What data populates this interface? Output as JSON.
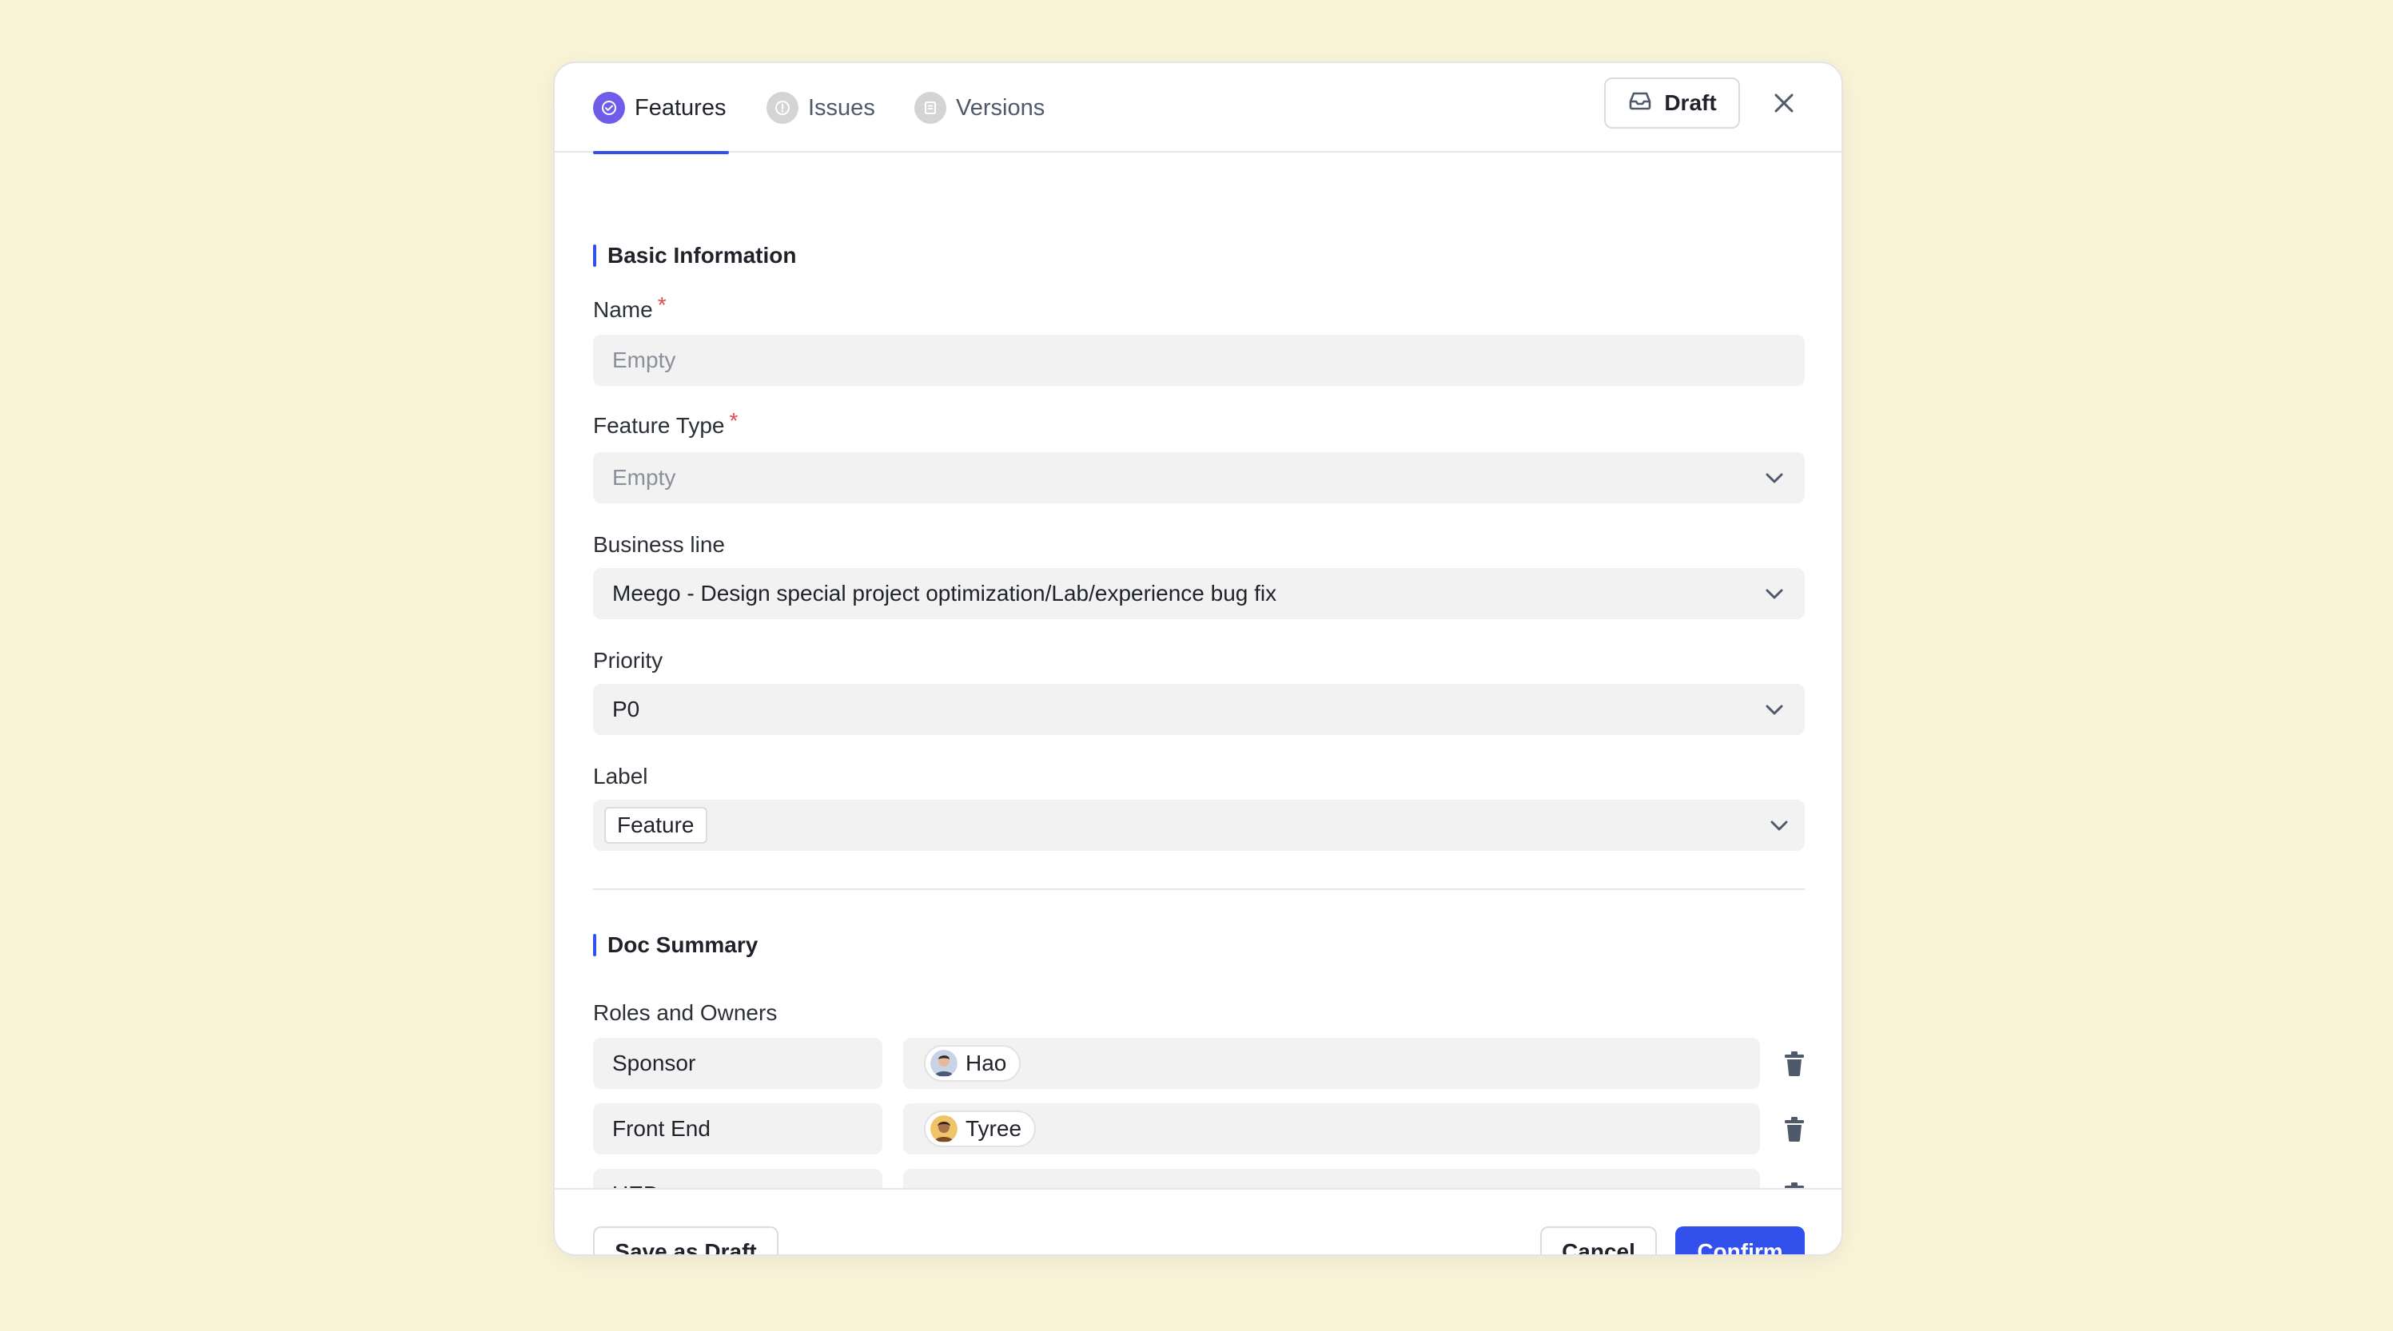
{
  "tabs": [
    {
      "label": "Features",
      "icon": "check-circle-icon",
      "active": true
    },
    {
      "label": "Issues",
      "icon": "alert-circle-icon",
      "active": false
    },
    {
      "label": "Versions",
      "icon": "bookmark-icon",
      "active": false
    }
  ],
  "header": {
    "draft_label": "Draft",
    "draft_icon": "inbox-icon",
    "close_icon": "close-icon"
  },
  "basic_info": {
    "title": "Basic Information",
    "name": {
      "label": "Name",
      "required": "*",
      "placeholder": "Empty"
    },
    "feature_type": {
      "label": "Feature Type",
      "required": "*",
      "placeholder": "Empty"
    },
    "business_line": {
      "label": "Business line",
      "value": "Meego - Design special project optimization/Lab/experience bug fix"
    },
    "priority": {
      "label": "Priority",
      "value": "P0"
    },
    "label": {
      "label": "Label",
      "tag": "Feature"
    }
  },
  "doc_summary": {
    "title": "Doc Summary",
    "roles_label": "Roles and Owners",
    "roles": [
      {
        "role": "Sponsor",
        "owner": "Hao"
      },
      {
        "role": "Front End",
        "owner": "Tyree"
      },
      {
        "role": "UED",
        "owner": ""
      }
    ]
  },
  "footer": {
    "save_draft": "Save as Draft",
    "cancel": "Cancel",
    "confirm": "Confirm"
  },
  "colors": {
    "accent": "#3250eb",
    "background": "#f8f3d6",
    "required": "#e5484d",
    "feature_icon": "#6f5ce8"
  }
}
